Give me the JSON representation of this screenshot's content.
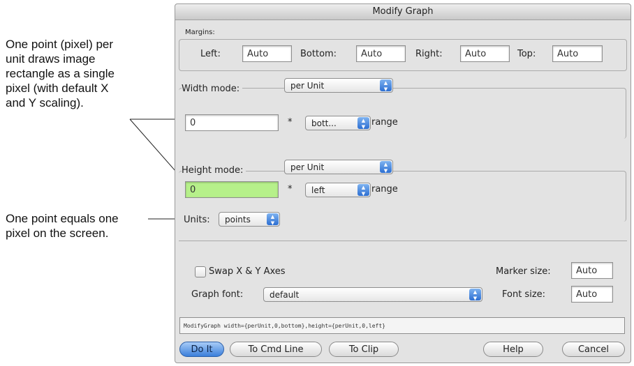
{
  "annotations": {
    "top": [
      "One point (pixel) per",
      "unit draws image",
      "rectangle as a single",
      "pixel (with default X",
      "and Y scaling)."
    ],
    "bottom": [
      "One point equals one",
      "pixel on the screen."
    ]
  },
  "dialog": {
    "title": "Modify Graph",
    "margins": {
      "label": "Margins:",
      "left_label": "Left:",
      "left_value": "Auto",
      "bottom_label": "Bottom:",
      "bottom_value": "Auto",
      "right_label": "Right:",
      "right_value": "Auto",
      "top_label": "Top:",
      "top_value": "Auto"
    },
    "width": {
      "mode_label": "Width mode:",
      "mode_value": "per Unit",
      "value": "0",
      "star": "*",
      "axis": "bott...",
      "range": "range"
    },
    "height": {
      "mode_label": "Height mode:",
      "mode_value": "per Unit",
      "value": "0",
      "star": "*",
      "axis": "left",
      "range": "range"
    },
    "units": {
      "label": "Units:",
      "value": "points"
    },
    "swap_label": "Swap X & Y Axes",
    "marker_size_label": "Marker size:",
    "marker_size_value": "Auto",
    "graph_font_label": "Graph font:",
    "graph_font_value": "default",
    "font_size_label": "Font size:",
    "font_size_value": "Auto",
    "command": "ModifyGraph width={perUnit,0,bottom},height={perUnit,0,left}",
    "buttons": {
      "do_it": "Do It",
      "to_cmd_line": "To Cmd Line",
      "to_clip": "To Clip",
      "help": "Help",
      "cancel": "Cancel"
    }
  }
}
